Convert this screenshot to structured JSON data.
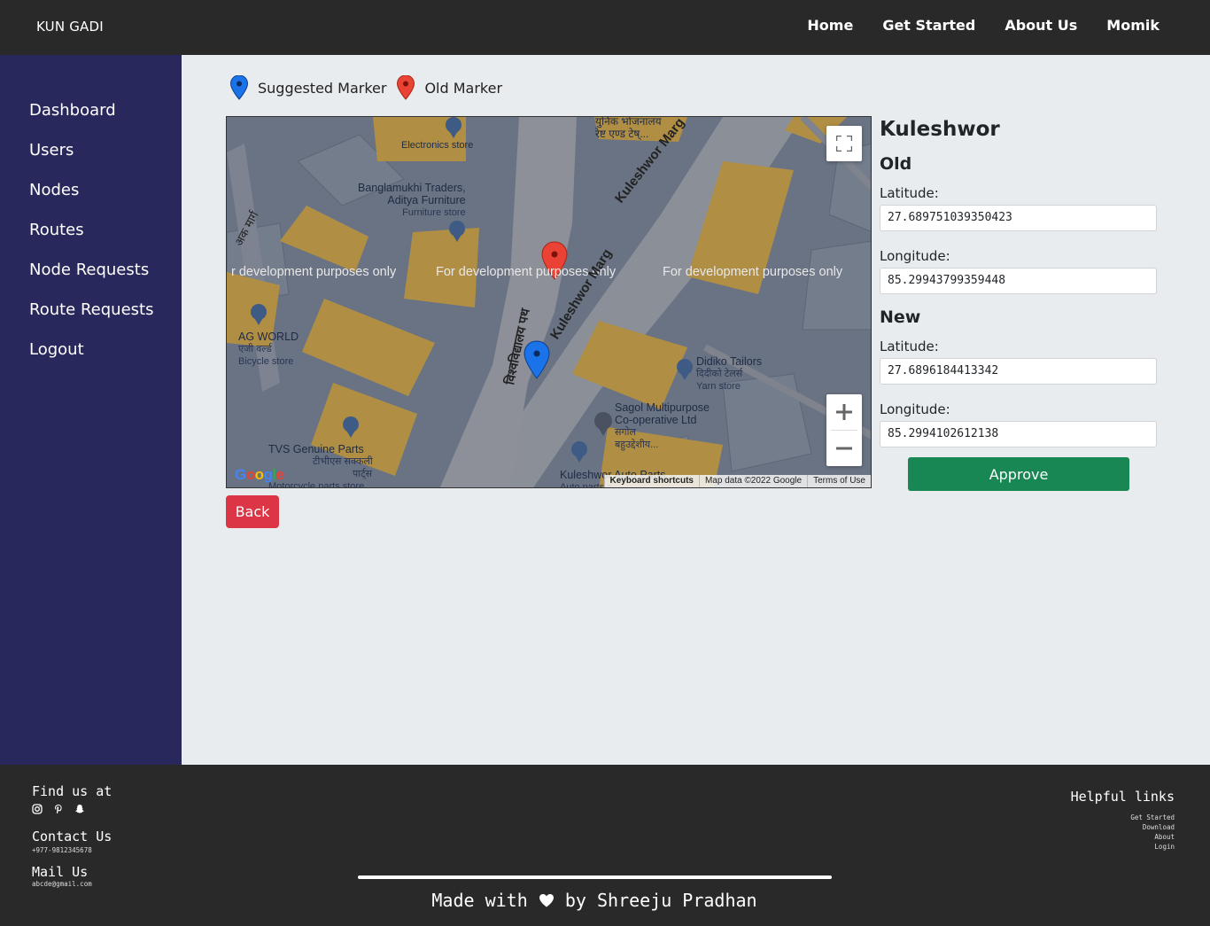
{
  "navbar": {
    "brand": "KUN GADI",
    "links": [
      "Home",
      "Get Started",
      "About Us",
      "Momik"
    ]
  },
  "sidebar": {
    "items": [
      "Dashboard",
      "Users",
      "Nodes",
      "Routes",
      "Node Requests",
      "Route Requests",
      "Logout"
    ]
  },
  "legend": {
    "suggested": "Suggested Marker",
    "old": "Old Marker",
    "suggested_color": "#1a73e8",
    "old_color": "#ea4335"
  },
  "map": {
    "dev_text": "For development purposes only",
    "dev_text_left": "r development purposes only",
    "road_1": "Kuleshwor Marg",
    "road_2": "Kuleshwor Marg",
    "road_3": "विश्वविद्यालय पथ",
    "road_4": "अक मार्ग",
    "pois": {
      "electronics": "Electronics store",
      "bank_np": "युनिक भोजनालय",
      "bank_np2": "रेष्ट एण्ड टेष्...",
      "banglamukhi": "Banglamukhi Traders,",
      "banglamukhi2": "Aditya Furniture",
      "banglamukhi_sub": "Furniture store",
      "agworld": "AG WORLD",
      "agworld_np": "एजी वर्ल्ड",
      "agworld_sub": "Bicycle store",
      "didiko": "Didiko Tailors",
      "didiko_np": "दिदीको टेलर्स",
      "didiko_sub": "Yarn store",
      "sagol": "Sagol Multipurpose",
      "sagol2": "Co-operative Ltd",
      "sagol_np": "सगोल",
      "sagol_np2": "बहुउद्देशीय...",
      "tvs": "TVS Genuine Parts",
      "tvs_np": "टीभीएस सक्कली",
      "tvs_np2": "पार्ट्स",
      "tvs_sub": "Motorcycle parts store",
      "kuleshwor_auto": "Kuleshwor Auto Parts",
      "kuleshwor_auto_sub": "Auto parts s..."
    },
    "attribution": {
      "keyboard": "Keyboard shortcuts",
      "data": "Map data ©2022 Google",
      "terms": "Terms of Use"
    },
    "google": "Google"
  },
  "details": {
    "place_name": "Kuleshwor",
    "old_title": "Old",
    "new_title": "New",
    "latitude_label": "Latitude:",
    "longitude_label": "Longitude:",
    "old_latitude": "27.689751039350423",
    "old_longitude": "85.29943799359448",
    "new_latitude": "27.6896184413342",
    "new_longitude": "85.2994102612138",
    "approve": "Approve"
  },
  "back_label": "Back",
  "footer": {
    "find_us": "Find us at",
    "contact_title": "Contact Us",
    "contact_phone": "+977-9812345678",
    "mail_title": "Mail Us",
    "mail": "abcde@gmail.com",
    "helpful_title": "Helpful links",
    "helpful_links": [
      "Get Started",
      "Download",
      "About",
      "Login"
    ],
    "credit_pre": "Made with",
    "credit_post": "by Shreeju Pradhan"
  }
}
